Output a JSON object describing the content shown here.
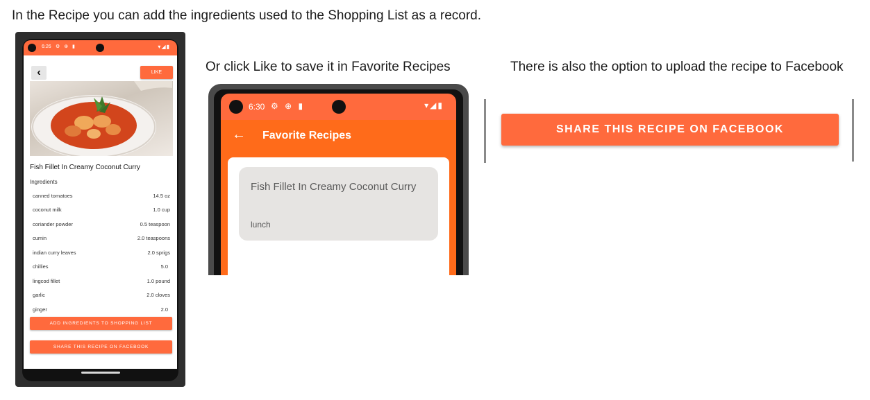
{
  "captions": {
    "intro": "In the Recipe you can add the ingredients used to the Shopping List as a record.",
    "like": "Or click Like to save it in Favorite Recipes",
    "facebook": "There is also the option to upload the recipe to Facebook"
  },
  "recipe_screen": {
    "status_time": "6:26",
    "like_label": "LIKE",
    "recipe_title": "Fish Fillet In Creamy Coconut Curry",
    "ingredients_label": "Ingredients",
    "ingredients": [
      {
        "name": "canned tomatoes",
        "qty": "14.5 oz"
      },
      {
        "name": "coconut milk",
        "qty": "1.0 cup"
      },
      {
        "name": "coriander powder",
        "qty": "0.5 teaspoon"
      },
      {
        "name": "cumin",
        "qty": "2.0 teaspoons"
      },
      {
        "name": "indian curry leaves",
        "qty": "2.0 sprigs"
      },
      {
        "name": "chillies",
        "qty": "5.0"
      },
      {
        "name": "lingcod fillet",
        "qty": "1.0 pound"
      },
      {
        "name": "garlic",
        "qty": "2.0 cloves"
      },
      {
        "name": "ginger",
        "qty": "2.0"
      }
    ],
    "add_button_label": "ADD INGREDIENTS TO SHOPPING LIST",
    "share_button_label": "SHARE THIS RECIPE ON FACEBOOK"
  },
  "favorites_screen": {
    "status_time": "6:30",
    "title": "Favorite Recipes",
    "card": {
      "title": "Fish Fillet In Creamy Coconut Curry",
      "category": "lunch"
    }
  },
  "share_button_large": "SHARE THIS RECIPE ON FACEBOOK",
  "colors": {
    "accent": "#ff6a3d",
    "toolbar": "#ff6b1a",
    "card": "#e6e4e2"
  }
}
